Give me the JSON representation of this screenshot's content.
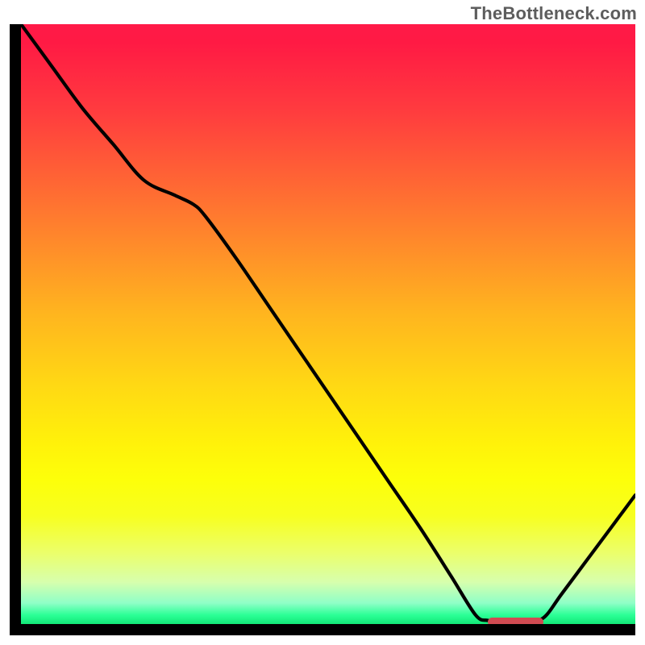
{
  "watermark": "TheBottleneck.com",
  "colors": {
    "axis": "#000000",
    "curve": "#000000",
    "marker": "#d04b52",
    "gradient_top": "#ff1a48",
    "gradient_bottom": "#12e877"
  },
  "chart_data": {
    "type": "line",
    "title": "",
    "xlabel": "",
    "ylabel": "",
    "xlim": [
      0,
      100
    ],
    "ylim": [
      0,
      100
    ],
    "x": [
      0,
      5,
      10,
      15,
      20,
      25,
      28,
      30,
      35,
      40,
      45,
      50,
      55,
      60,
      65,
      70,
      74,
      76,
      78,
      82,
      85,
      88,
      92,
      96,
      100
    ],
    "y": [
      100,
      93,
      86,
      80,
      74,
      71.5,
      70,
      68,
      61,
      53.5,
      46,
      38.5,
      31,
      23.5,
      16,
      8,
      1.5,
      0.6,
      0.5,
      0.5,
      1,
      5,
      10.5,
      16,
      21.5
    ],
    "marker_xrange": [
      76,
      85
    ],
    "marker_y": 0.4,
    "note": "Values estimated from pixel positions; y=0 is plot bottom (green), y=100 is plot top (red)."
  }
}
